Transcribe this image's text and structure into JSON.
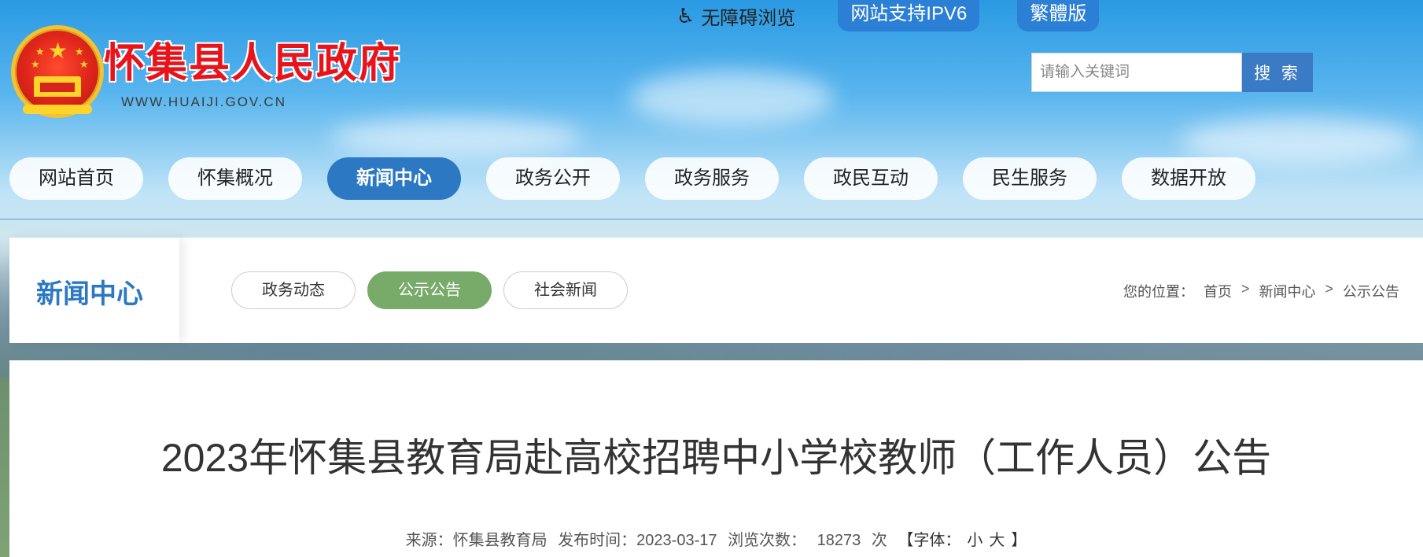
{
  "header": {
    "site_name": "怀集县人民政府",
    "site_domain": "WWW.HUAIJI.GOV.CN",
    "accessibility_label": "无障碍浏览",
    "ipv6_label": "网站支持IPV6",
    "traditional_label": "繁體版",
    "search": {
      "placeholder": "请输入关键词",
      "button_label": "搜 索"
    }
  },
  "nav": {
    "items": [
      {
        "label": "网站首页"
      },
      {
        "label": "怀集概况"
      },
      {
        "label": "新闻中心"
      },
      {
        "label": "政务公开"
      },
      {
        "label": "政务服务"
      },
      {
        "label": "政民互动"
      },
      {
        "label": "民生服务"
      },
      {
        "label": "数据开放"
      }
    ],
    "active_index": 2
  },
  "section": {
    "title": "新闻中心",
    "tabs": [
      {
        "label": "政务动态"
      },
      {
        "label": "公示公告"
      },
      {
        "label": "社会新闻"
      }
    ],
    "active_tab": 1,
    "breadcrumb": {
      "prefix": "您的位置：",
      "items": [
        "首页",
        "新闻中心",
        "公示公告"
      ],
      "separator": ">"
    }
  },
  "article": {
    "title": "2023年怀集县教育局赴高校招聘中小学校教师（工作人员）公告",
    "source": "来源：怀集县教育局",
    "publish_time": "发布时间：2023-03-17",
    "views_label": "浏览次数：",
    "views_count": "18273",
    "views_unit": "次",
    "font_label": "【字体：",
    "font_small": "小",
    "font_large": "大",
    "font_close": "】"
  },
  "colors": {
    "brand_blue": "#2c78c3",
    "active_green": "#78aa6a",
    "title_red": "#e8141b"
  }
}
